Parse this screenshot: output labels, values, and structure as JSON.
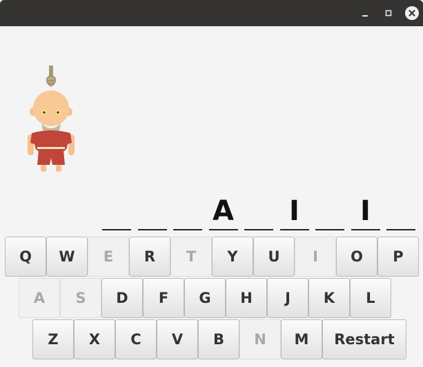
{
  "window": {
    "controls": [
      "minimize-icon",
      "maximize-icon",
      "close-icon"
    ]
  },
  "game": {
    "figure_icon": "hanged-man-figure",
    "word_slots": [
      "",
      "",
      "",
      "A",
      "",
      "I",
      "",
      "I",
      ""
    ]
  },
  "keyboard": {
    "rows": [
      [
        {
          "label": "Q",
          "used": false
        },
        {
          "label": "W",
          "used": false
        },
        {
          "label": "E",
          "used": true
        },
        {
          "label": "R",
          "used": false
        },
        {
          "label": "T",
          "used": true
        },
        {
          "label": "Y",
          "used": false
        },
        {
          "label": "U",
          "used": false
        },
        {
          "label": "I",
          "used": true
        },
        {
          "label": "O",
          "used": false
        },
        {
          "label": "P",
          "used": false
        }
      ],
      [
        {
          "label": "A",
          "used": true
        },
        {
          "label": "S",
          "used": true
        },
        {
          "label": "D",
          "used": false
        },
        {
          "label": "F",
          "used": false
        },
        {
          "label": "G",
          "used": false
        },
        {
          "label": "H",
          "used": false
        },
        {
          "label": "J",
          "used": false
        },
        {
          "label": "K",
          "used": false
        },
        {
          "label": "L",
          "used": false
        }
      ],
      [
        {
          "label": "Z",
          "used": false
        },
        {
          "label": "X",
          "used": false
        },
        {
          "label": "C",
          "used": false
        },
        {
          "label": "V",
          "used": false
        },
        {
          "label": "B",
          "used": false
        },
        {
          "label": "N",
          "used": true
        },
        {
          "label": "M",
          "used": false
        }
      ]
    ],
    "restart_label": "Restart"
  }
}
